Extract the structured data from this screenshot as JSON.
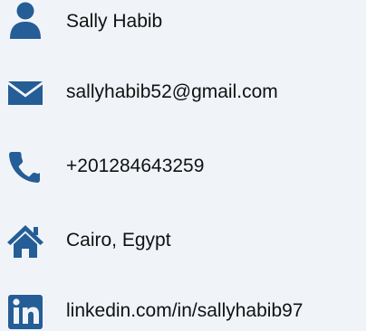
{
  "accent_color": "#255d96",
  "contact": {
    "name": {
      "icon": "user-icon",
      "text": "Sally Habib"
    },
    "email": {
      "icon": "envelope-icon",
      "text": "sallyhabib52@gmail.com"
    },
    "phone": {
      "icon": "phone-icon",
      "text": "+201284643259"
    },
    "location": {
      "icon": "home-icon",
      "text": "Cairo, Egypt"
    },
    "linkedin": {
      "icon": "linkedin-icon",
      "text": "linkedin.com/in/sallyhabib97"
    }
  }
}
